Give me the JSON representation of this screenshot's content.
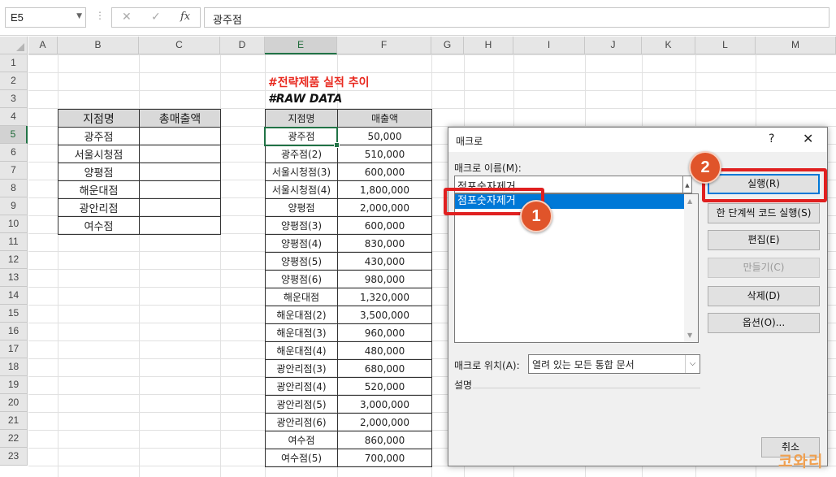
{
  "formula_bar": {
    "name_box": "E5",
    "cancel_glyph": "✕",
    "enter_glyph": "✓",
    "fx_glyph": "fx",
    "content": "광주점"
  },
  "columns": [
    "A",
    "B",
    "C",
    "D",
    "E",
    "F",
    "G",
    "H",
    "I",
    "J",
    "K",
    "L",
    "M"
  ],
  "rows": [
    "1",
    "2",
    "3",
    "4",
    "5",
    "6",
    "7",
    "8",
    "9",
    "10",
    "11",
    "12",
    "13",
    "14",
    "15",
    "16",
    "17",
    "18",
    "19",
    "20",
    "21",
    "22",
    "23"
  ],
  "sheet": {
    "title": "#전략제품 실적 추이",
    "subtitle": "#RAW DATA",
    "summary_table": {
      "headers": [
        "지점명",
        "총매출액"
      ],
      "rows": [
        [
          "광주점",
          ""
        ],
        [
          "서울시청점",
          ""
        ],
        [
          "양평점",
          ""
        ],
        [
          "해운대점",
          ""
        ],
        [
          "광안리점",
          ""
        ],
        [
          "여수점",
          ""
        ]
      ]
    },
    "raw_table": {
      "headers": [
        "지점명",
        "매출액"
      ],
      "rows": [
        [
          "광주점",
          "50,000"
        ],
        [
          "광주점(2)",
          "510,000"
        ],
        [
          "서울시청점(3)",
          "600,000"
        ],
        [
          "서울시청점(4)",
          "1,800,000"
        ],
        [
          "양평점",
          "2,000,000"
        ],
        [
          "양평점(3)",
          "600,000"
        ],
        [
          "양평점(4)",
          "830,000"
        ],
        [
          "양평점(5)",
          "430,000"
        ],
        [
          "양평점(6)",
          "980,000"
        ],
        [
          "해운대점",
          "1,320,000"
        ],
        [
          "해운대점(2)",
          "3,500,000"
        ],
        [
          "해운대점(3)",
          "960,000"
        ],
        [
          "해운대점(4)",
          "480,000"
        ],
        [
          "광안리점(3)",
          "680,000"
        ],
        [
          "광안리점(4)",
          "520,000"
        ],
        [
          "광안리점(5)",
          "3,000,000"
        ],
        [
          "광안리점(6)",
          "2,000,000"
        ],
        [
          "여수점",
          "860,000"
        ],
        [
          "여수점(5)",
          "700,000"
        ]
      ]
    }
  },
  "dialog": {
    "title": "매크로",
    "help": "?",
    "close": "✕",
    "name_label": "매크로 이름(M):",
    "name_value": "점포숫자제거",
    "list_items": [
      "점포숫자제거"
    ],
    "buttons": {
      "run": "실행(R)",
      "step": "한 단계씩 코드 실행(S)",
      "edit": "편집(E)",
      "create": "만들기(C)",
      "delete": "삭제(D)",
      "options": "옵션(O)...",
      "cancel": "취소"
    },
    "location_label": "매크로 위치(A):",
    "location_value": "열려 있는 모든 통합 문서",
    "description_label": "설명"
  },
  "annotations": {
    "badge_1": "1",
    "badge_2": "2",
    "highlight_color": "#e02020",
    "badge_color": "#e0542a"
  },
  "watermark": {
    "text": "코와리"
  },
  "colors": {
    "excel_green": "#217346",
    "selection_blue": "#0078d7",
    "title_red": "#e8291f"
  }
}
